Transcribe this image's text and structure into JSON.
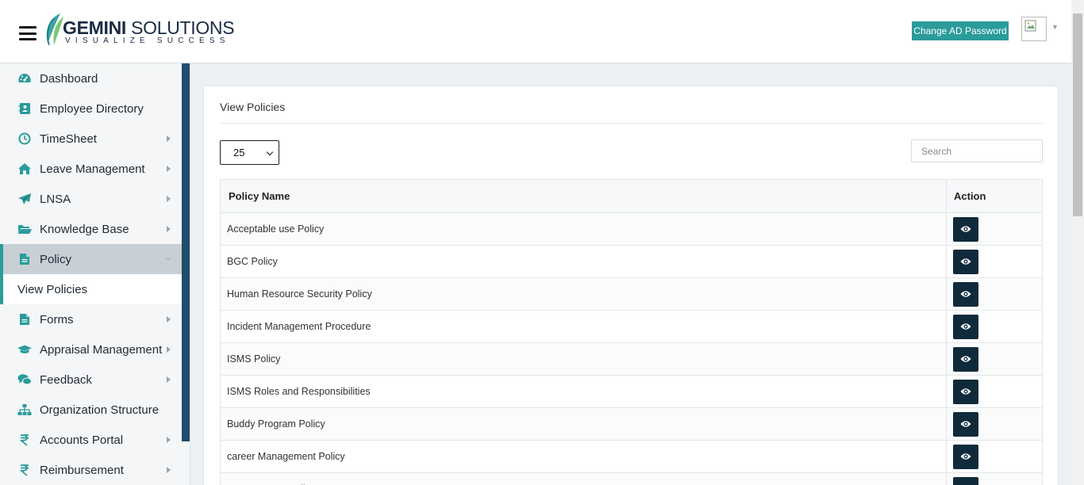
{
  "header": {
    "brand_name": "GEMINI",
    "brand_name2": " SOLUTIONS",
    "brand_tagline": "VISUALIZE SUCCESS",
    "change_password_label": "Change AD Password"
  },
  "colors": {
    "accent": "#2b9b9b",
    "sidebar_rail": "#1f4d6b",
    "view_button": "#0f2a3a"
  },
  "sidebar": {
    "items": [
      {
        "label": "Dashboard",
        "icon": "dashboard-icon",
        "has_arrow": false
      },
      {
        "label": "Employee Directory",
        "icon": "address-book-icon",
        "has_arrow": false
      },
      {
        "label": "TimeSheet",
        "icon": "clock-icon",
        "has_arrow": true
      },
      {
        "label": "Leave Management",
        "icon": "home-icon",
        "has_arrow": true
      },
      {
        "label": "LNSA",
        "icon": "paper-plane-icon",
        "has_arrow": true
      },
      {
        "label": "Knowledge Base",
        "icon": "folder-open-icon",
        "has_arrow": true
      },
      {
        "label": "Policy",
        "icon": "document-icon",
        "has_arrow": true,
        "active": true
      },
      {
        "label": "Forms",
        "icon": "document-icon",
        "has_arrow": true
      },
      {
        "label": "Appraisal Management",
        "icon": "graduation-cap-icon",
        "has_arrow": true
      },
      {
        "label": "Feedback",
        "icon": "chat-bubbles-icon",
        "has_arrow": true
      },
      {
        "label": "Organization Structure",
        "icon": "sitemap-icon",
        "has_arrow": false
      },
      {
        "label": "Accounts Portal",
        "icon": "rupee-icon",
        "has_arrow": true
      },
      {
        "label": "Reimbursement",
        "icon": "rupee-icon",
        "has_arrow": true
      }
    ],
    "submenu": {
      "label": "View Policies"
    }
  },
  "main": {
    "title": "View Policies",
    "page_size": "25",
    "search_placeholder": "Search",
    "table": {
      "columns": [
        "Policy Name",
        "Action"
      ],
      "rows": [
        "Acceptable use Policy",
        "BGC Policy",
        "Human Resource Security Policy",
        "Incident Management Procedure",
        "ISMS Policy",
        "ISMS Roles and Responsibilities",
        "Buddy Program Policy",
        "career Management Policy",
        "Bereavement Policy"
      ],
      "action_icon": "eye-icon"
    }
  }
}
